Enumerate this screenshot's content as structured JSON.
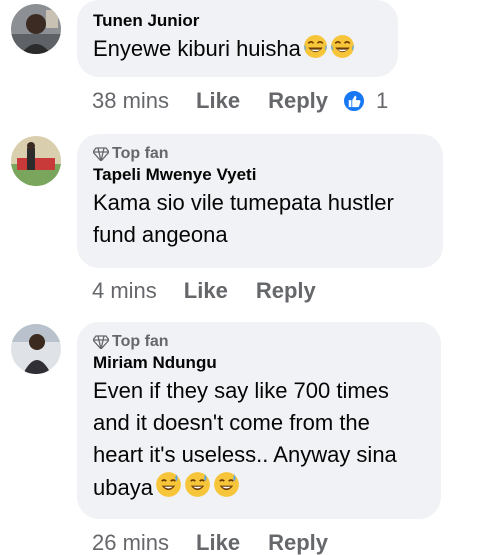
{
  "comments": [
    {
      "author": "Tunen Junior",
      "top_fan": false,
      "text": "Enyewe kiburi huisha",
      "emoji_count": 2,
      "time": "38 mins",
      "like_label": "Like",
      "reply_label": "Reply",
      "reaction_icon": "like-icon",
      "reaction_count": "1"
    },
    {
      "author": "Tapeli Mwenye Vyeti",
      "top_fan": true,
      "badge_label": "Top fan",
      "text_lines": [
        "Kama sio vile tumepata hustler",
        "fund angeona"
      ],
      "time": "4 mins",
      "like_label": "Like",
      "reply_label": "Reply"
    },
    {
      "author": "Miriam Ndungu",
      "top_fan": true,
      "badge_label": "Top fan",
      "text_lines": [
        "Even if they say like 700 times",
        "and it doesn't come from the",
        "heart it's useless.. Anyway sina",
        "ubaya"
      ],
      "emoji_count": 3,
      "time": "26 mins",
      "like_label": "Like",
      "reply_label": "Reply"
    }
  ],
  "colors": {
    "bubble": "#f0f2f5",
    "meta": "#65676b",
    "like_blue": "#1877f2"
  }
}
